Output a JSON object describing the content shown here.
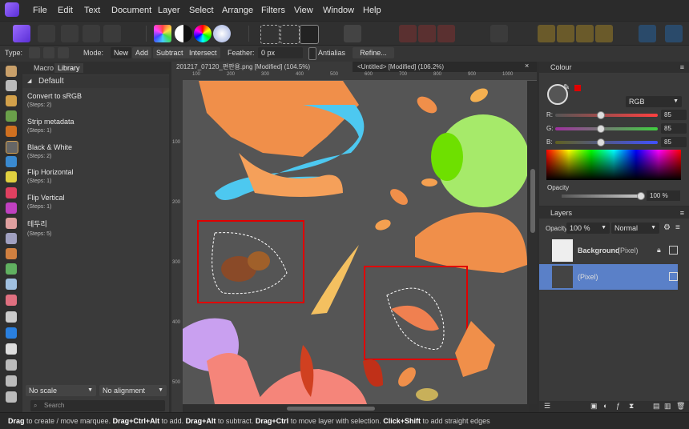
{
  "menu": [
    "File",
    "Edit",
    "Text",
    "Document",
    "Layer",
    "Select",
    "Arrange",
    "Filters",
    "View",
    "Window",
    "Help"
  ],
  "context": {
    "type_label": "Type:",
    "mode_label": "Mode:",
    "modes": [
      "New",
      "Add",
      "Subtract",
      "Intersect"
    ],
    "feather_label": "Feather:",
    "feather_value": "0 px",
    "antialias_label": "Antialias",
    "refine_label": "Refine..."
  },
  "macro_panel": {
    "tabs": [
      "Macro",
      "Library"
    ],
    "category": "Default",
    "items": [
      {
        "name": "Convert to sRGB",
        "steps": "(Steps: 2)"
      },
      {
        "name": "Strip metadata",
        "steps": "(Steps: 1)"
      },
      {
        "name": "Black & White",
        "steps": "(Steps: 2)"
      },
      {
        "name": "Flip Horizontal",
        "steps": "(Steps: 1)"
      },
      {
        "name": "Flip Vertical",
        "steps": "(Steps: 1)"
      },
      {
        "name": "테두리",
        "steps": "(Steps: 5)"
      }
    ],
    "scale_option": "No scale",
    "alignment_option": "No alignment",
    "search_placeholder": "Search"
  },
  "documents": {
    "tab1": "201217_07120_편판용.png [Modified] (104.5%)",
    "tab2": "<Untitled> [Modified] (106.2%)",
    "close": "×"
  },
  "rulers": {
    "h": [
      "100",
      "200",
      "300",
      "400",
      "500",
      "600",
      "700",
      "800",
      "900",
      "1000"
    ],
    "v": [
      "100",
      "200",
      "300",
      "400",
      "500",
      "600"
    ]
  },
  "colour_panel": {
    "title": "Colour",
    "model": "RGB",
    "channels": [
      {
        "label": "R:",
        "value": "85",
        "color": "#d04040"
      },
      {
        "label": "G:",
        "value": "85",
        "color": "#40b040"
      },
      {
        "label": "B:",
        "value": "85",
        "color": "#4060d0"
      }
    ],
    "opacity_label": "Opacity",
    "opacity_value": "100 %",
    "accent_red": "#e00000"
  },
  "layers_panel": {
    "title": "Layers",
    "opacity_label": "Opacity:",
    "opacity_value": "100 %",
    "blend_mode": "Normal",
    "layers": [
      {
        "name": "Background",
        "kind": "(Pixel)"
      },
      {
        "name": "",
        "kind": "(Pixel)"
      }
    ]
  },
  "status": {
    "k1": "Drag",
    "t1": " to create / move marquee. ",
    "k2": "Drag+Ctrl+Alt",
    "t2": " to add. ",
    "k3": "Drag+Alt",
    "t3": " to subtract. ",
    "k4": "Drag+Ctrl",
    "t4": " to move layer with selection. ",
    "k5": "Click+Shift",
    "t5": " to add straight edges"
  }
}
